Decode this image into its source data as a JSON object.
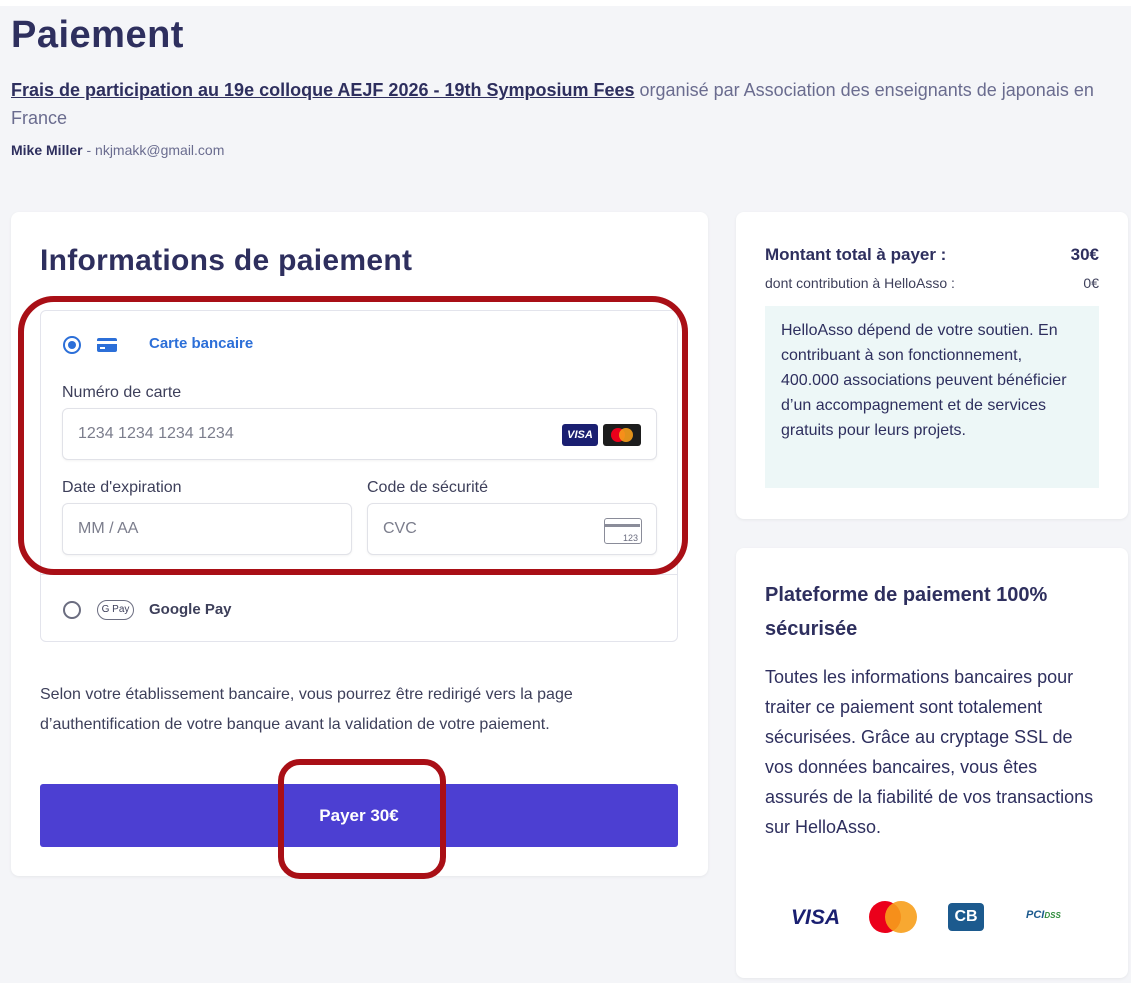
{
  "header": {
    "title": "Paiement",
    "campaign_link": "Frais de participation au 19e colloque AEJF 2026 - 19th Symposium Fees",
    "organized_by": " organisé par Association des enseignants de japonais en France",
    "payer_name": "Mike Miller",
    "payer_email": " - nkjmakk@gmail.com"
  },
  "payment": {
    "heading": "Informations de paiement",
    "method_card_label": "Carte bancaire",
    "card_number_label": "Numéro de carte",
    "card_number_placeholder": "1234 1234 1234 1234",
    "expiry_label": "Date d'expiration",
    "expiry_placeholder": "MM / AA",
    "cvc_label": "Code de sécurité",
    "cvc_placeholder": "CVC",
    "cvc_icon_text": "123",
    "visa_badge": "VISA",
    "gpay_badge": "G Pay",
    "method_gpay_label": "Google Pay",
    "notice": "Selon votre établissement bancaire, vous pourrez être redirigé vers la page d’authentification de votre banque avant la validation de votre paiement.",
    "pay_button": "Payer 30€"
  },
  "summary": {
    "total_label": "Montant total à payer :",
    "total_value": "30€",
    "contribution_label": "dont contribution à HelloAsso :",
    "contribution_value": "0€",
    "support_text": "HelloAsso dépend de votre soutien. En contribuant à son fonctionnement, 400.000 associations peuvent bénéficier d’un accompagnement et de services gratuits pour leurs projets."
  },
  "security": {
    "title": "Plateforme de paiement 100% sécurisée",
    "text": "Toutes les informations bancaires pour traiter ce paiement sont totalement sécurisées. Grâce au cryptage SSL de vos données bancaires, vous êtes assurés de la fiabilité de vos transactions sur HelloAsso.",
    "logos": {
      "visa": "VISA",
      "cb": "CB",
      "pci": "PCI",
      "pci_sub": "DSS"
    }
  },
  "colors": {
    "primary": "#4c3fd2",
    "accent_blue": "#2c6fd8",
    "text_dark": "#2e2f5e",
    "highlight_red": "#a90f16",
    "support_bg": "#edf7f7"
  }
}
